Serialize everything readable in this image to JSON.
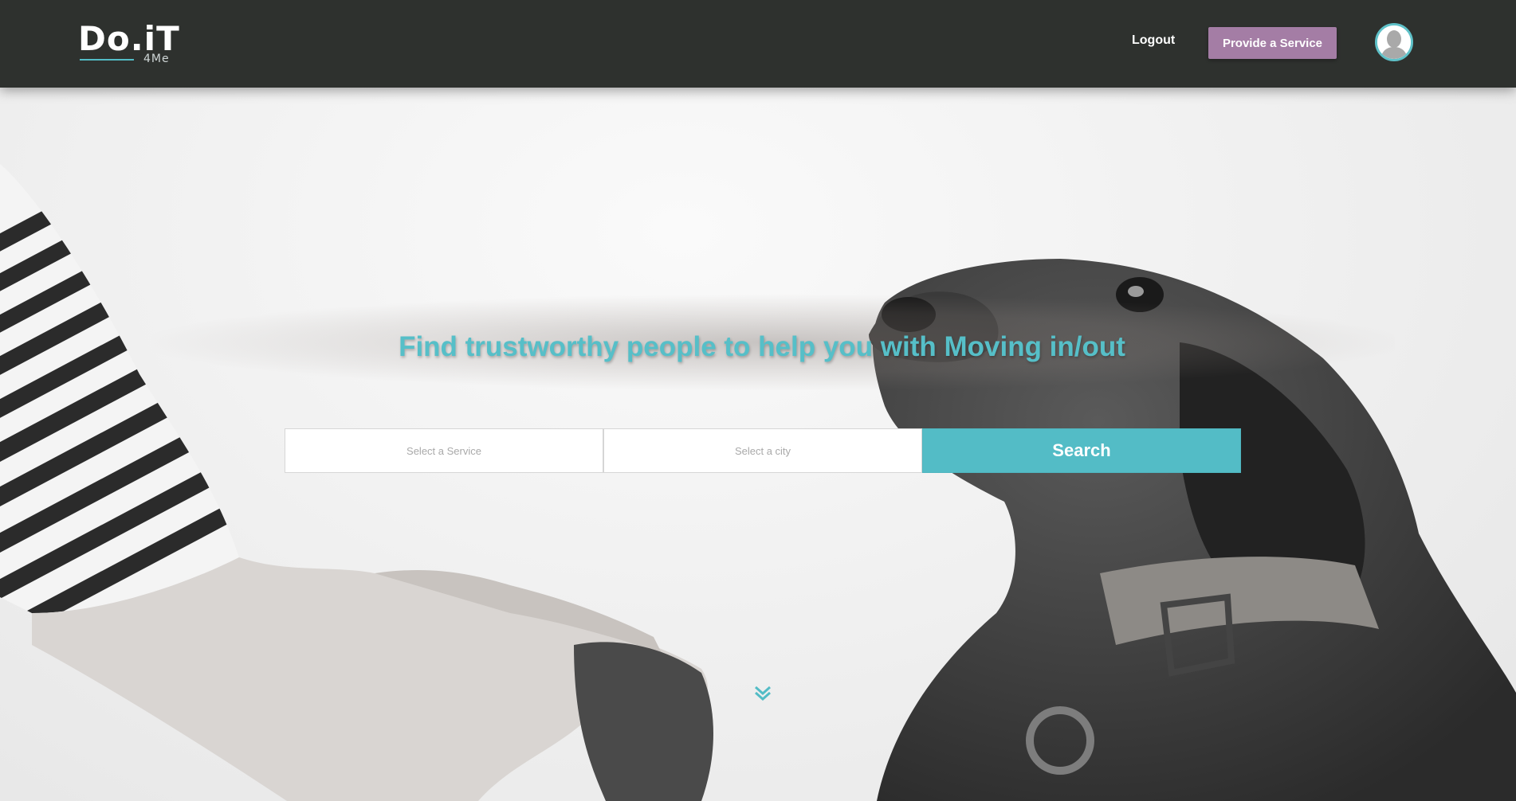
{
  "header": {
    "logo_main": "Do.iT",
    "logo_sub": "4Me",
    "logout_label": "Logout",
    "provide_label": "Provide a Service",
    "avatar_icon": "user-avatar-icon"
  },
  "hero": {
    "title": "Find trustworthy people to help you with Moving in/out",
    "service_placeholder": "Select a Service",
    "city_placeholder": "Select a city",
    "search_label": "Search",
    "scroll_icon": "double-chevron-down-icon"
  },
  "colors": {
    "header_bg": "#2e312e",
    "accent": "#53bcc6",
    "provide_button": "#a47da5"
  }
}
